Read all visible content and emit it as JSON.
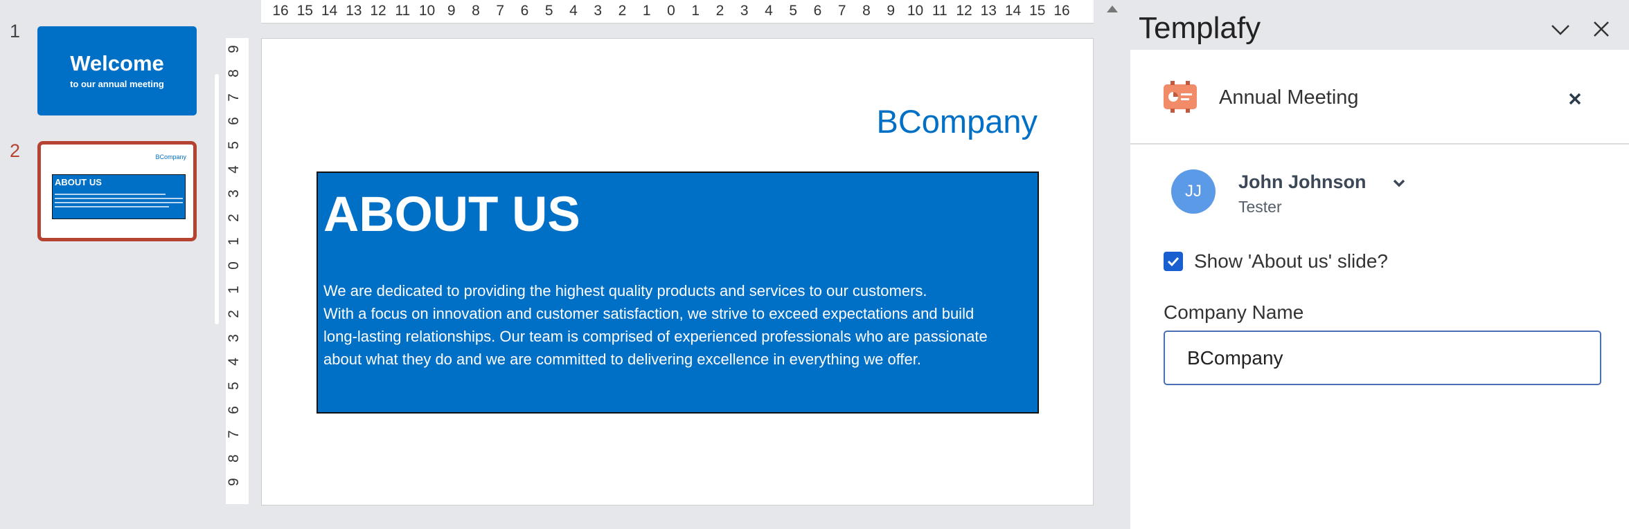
{
  "thumbnails": {
    "items": [
      {
        "number": "1",
        "title": "Welcome",
        "subtitle": "to our annual meeting"
      },
      {
        "number": "2",
        "title": "ABOUT US",
        "brand": "BCompany"
      }
    ]
  },
  "ruler": {
    "horizontal": [
      "16",
      "15",
      "14",
      "13",
      "12",
      "11",
      "10",
      "9",
      "8",
      "7",
      "6",
      "5",
      "4",
      "3",
      "2",
      "1",
      "0",
      "1",
      "2",
      "3",
      "4",
      "5",
      "6",
      "7",
      "8",
      "9",
      "10",
      "11",
      "12",
      "13",
      "14",
      "15",
      "16"
    ],
    "vertical": [
      "9",
      "8",
      "7",
      "6",
      "5",
      "4",
      "3",
      "2",
      "1",
      "0",
      "1",
      "2",
      "3",
      "4",
      "5",
      "6",
      "7",
      "8",
      "9"
    ]
  },
  "slide": {
    "brand": "BCompany",
    "title": "ABOUT US",
    "body_lines": [
      "We are dedicated to providing the highest quality products and services to our customers.",
      "With a focus on innovation and customer satisfaction, we strive to exceed expectations and build",
      "long-lasting relationships. Our team is comprised of experienced professionals who are passionate",
      "about what they do and we are committed to delivering excellence in everything we offer."
    ]
  },
  "pane": {
    "title": "Templafy",
    "template_name": "Annual Meeting",
    "user": {
      "initials": "JJ",
      "name": "John Johnson",
      "role": "Tester"
    },
    "checkbox_label": "Show 'About us' slide?",
    "checkbox_checked": true,
    "company_label": "Company Name",
    "company_value": "BCompany"
  },
  "colors": {
    "accent_blue": "#0070c7",
    "selection_red": "#b5432f",
    "avatar_blue": "#5b9ae6",
    "checkbox_blue": "#1a5fcf",
    "icon_orange": "#f28b68"
  }
}
